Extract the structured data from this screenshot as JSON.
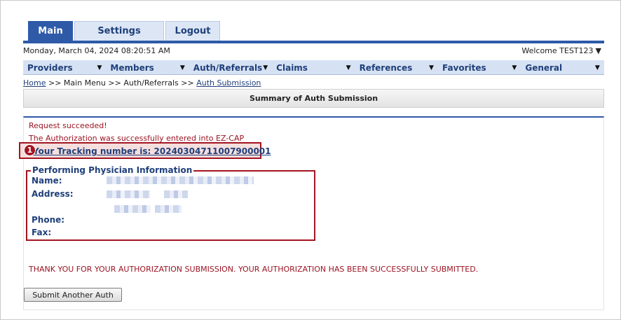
{
  "tabs": [
    {
      "label": "Main",
      "active": true
    },
    {
      "label": "Settings",
      "active": false
    },
    {
      "label": "Logout",
      "active": false
    }
  ],
  "header": {
    "datetime": "Monday, March 04, 2024 08:20:51 AM",
    "welcome": "Welcome TEST123"
  },
  "nav": [
    {
      "label": "Providers"
    },
    {
      "label": "Members"
    },
    {
      "label": "Auth/Referrals"
    },
    {
      "label": "Claims"
    },
    {
      "label": "References"
    },
    {
      "label": "Favorites"
    },
    {
      "label": "General"
    }
  ],
  "breadcrumb": {
    "home": "Home",
    "sep1": " >> ",
    "main_menu": "Main Menu",
    "sep2": " >> ",
    "auth_referrals": "Auth/Referrals",
    "sep3": " >> ",
    "current": "Auth Submission"
  },
  "section": {
    "title": "Summary of Auth Submission"
  },
  "messages": {
    "success": "Request succeeded!",
    "entered": "The Authorization was successfully entered into EZ-CAP",
    "tracking": "Your Tracking number is: 20240304711007900001",
    "callout_number": "1"
  },
  "physician": {
    "legend": "Performing Physician Information",
    "name_label": "Name:",
    "address_label": "Address:",
    "phone_label": "Phone:",
    "fax_label": "Fax:"
  },
  "thanks": "THANK YOU FOR YOUR AUTHORIZATION SUBMISSION. YOUR AUTHORIZATION HAS BEEN SUCCESSFULLY SUBMITTED.",
  "buttons": {
    "submit_another": "Submit Another Auth"
  },
  "colors": {
    "primary": "#2e5aa8",
    "nav_bg": "#d6e2f3",
    "alert_red": "#9a1422",
    "highlight_border": "#a31520"
  }
}
